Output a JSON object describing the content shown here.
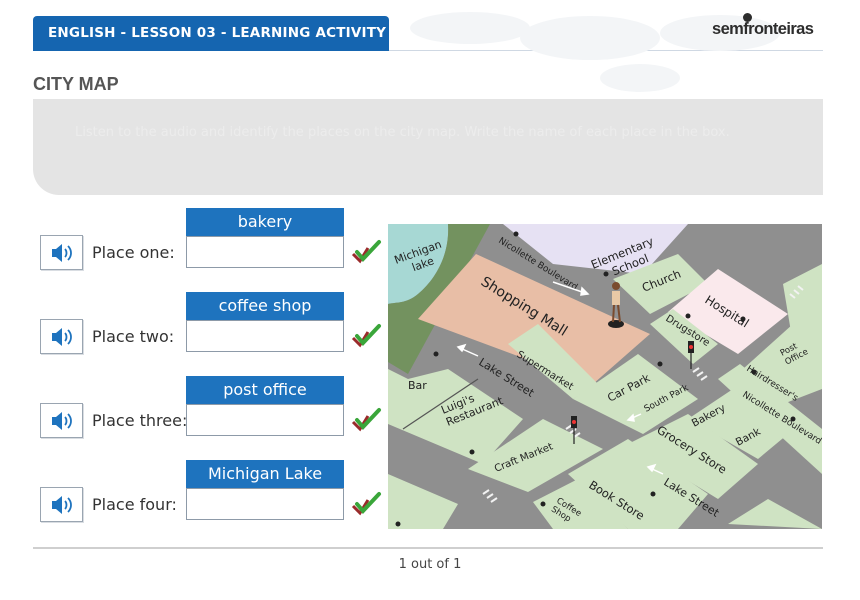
{
  "header": {
    "title": "ENGLISH - LESSON 03 - LEARNING ACTIVITY",
    "brand": "semfronteiras"
  },
  "page_title": "CITY MAP",
  "instructions": {
    "text": "Listen to the audio and identify the places on the city map. Write the name of each place in the box."
  },
  "rows": [
    {
      "label": "Place one:",
      "answer": "bakery",
      "input_value": ""
    },
    {
      "label": "Place two:",
      "answer": "coffee shop",
      "input_value": ""
    },
    {
      "label": "Place three:",
      "answer": "post office",
      "input_value": ""
    },
    {
      "label": "Place four:",
      "answer": "Michigan Lake",
      "input_value": ""
    }
  ],
  "map": {
    "labels": {
      "michigan_lake": [
        "Michigan",
        "lake"
      ],
      "nicollette_blvd_top": "Nicollette Boulevard",
      "elementary_school": [
        "Elementary",
        "School"
      ],
      "church": "Church",
      "hospital": "Hospital",
      "shopping_mall": "Shopping Mall",
      "drugstore": "Drugstore",
      "supermarket": "Supermarket",
      "lake_street_top": "Lake Street",
      "bar": "Bar",
      "luigis": [
        "Luigi's",
        "Restaurant"
      ],
      "car_park": "Car Park",
      "south_park": "South Park",
      "post_office": [
        "Post",
        "Office"
      ],
      "hairdressers": "Hairdresser's",
      "nicollette_blvd_right": "Nicollette Boulevard",
      "bakery": "Bakery",
      "bank": "Bank",
      "grocery_store": "Grocery Store",
      "craft_market": "Craft Market",
      "book_store": "Book Store",
      "lake_street_bottom": "Lake Street",
      "coffee_shop": [
        "Coffee",
        "Shop"
      ]
    }
  },
  "footer": {
    "pagination": "1 out of 1"
  },
  "colors": {
    "header_blue": "#1565b0",
    "chip_blue": "#1e73be",
    "road": "#8c8c8c",
    "block_green": "#cfe3c3",
    "mall": "#e8bea6",
    "lake": "#9fd3d0"
  }
}
